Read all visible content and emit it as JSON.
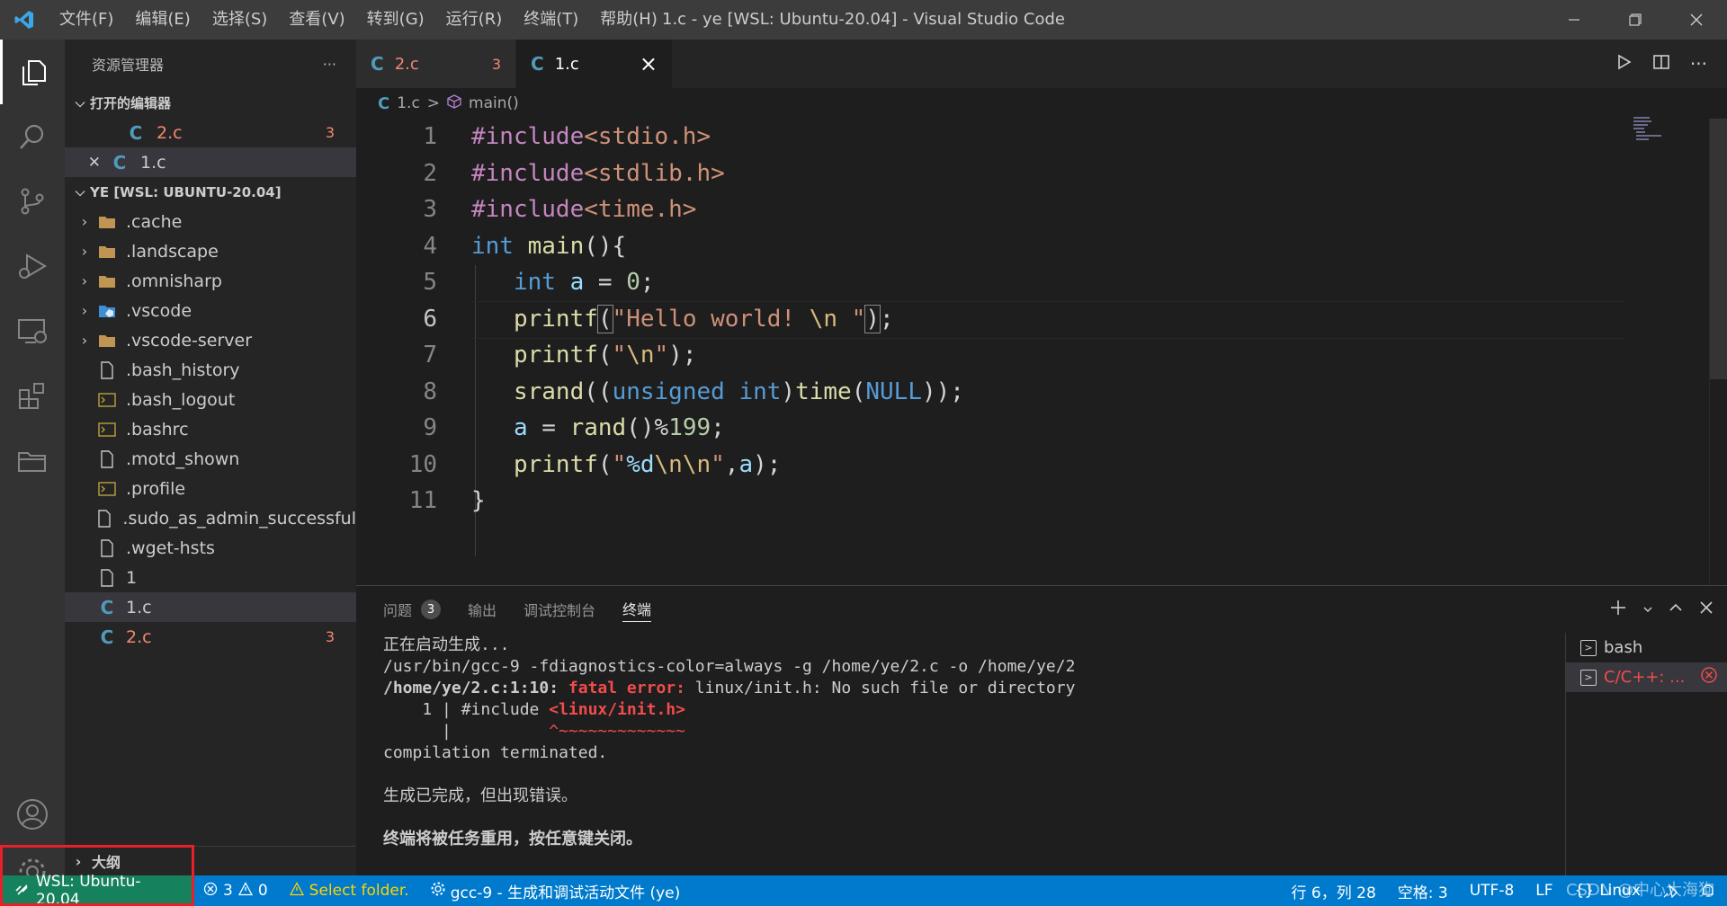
{
  "titlebar": {
    "menu": [
      "文件(F)",
      "编辑(E)",
      "选择(S)",
      "查看(V)",
      "转到(G)",
      "运行(R)",
      "终端(T)",
      "帮助(H)"
    ],
    "title": "1.c - ye [WSL: Ubuntu-20.04] - Visual Studio Code"
  },
  "sidebar": {
    "header": "资源管理器",
    "more": "···",
    "open_editors_label": "打开的编辑器",
    "open_editors": [
      {
        "name": "2.c",
        "badge": "3",
        "icon": "c-file-icon",
        "error": true
      },
      {
        "name": "1.c",
        "badge": "",
        "icon": "c-file-icon",
        "error": false
      }
    ],
    "workspace_label": "YE [WSL: UBUNTU-20.04]",
    "files": [
      {
        "name": ".cache",
        "kind": "folder"
      },
      {
        "name": ".landscape",
        "kind": "folder"
      },
      {
        "name": ".omnisharp",
        "kind": "folder"
      },
      {
        "name": ".vscode",
        "kind": "vscode-folder"
      },
      {
        "name": ".vscode-server",
        "kind": "folder"
      },
      {
        "name": ".bash_history",
        "kind": "file"
      },
      {
        "name": ".bash_logout",
        "kind": "shell"
      },
      {
        "name": ".bashrc",
        "kind": "shell"
      },
      {
        "name": ".motd_shown",
        "kind": "file"
      },
      {
        "name": ".profile",
        "kind": "shell"
      },
      {
        "name": ".sudo_as_admin_successful",
        "kind": "file"
      },
      {
        "name": ".wget-hsts",
        "kind": "file"
      },
      {
        "name": "1",
        "kind": "file"
      },
      {
        "name": "1.c",
        "kind": "c"
      },
      {
        "name": "2.c",
        "kind": "c",
        "badge": "3"
      }
    ],
    "outline_label": "大纲"
  },
  "editor": {
    "tabs": [
      {
        "label": "2.c",
        "badge": "3",
        "active": false
      },
      {
        "label": "1.c",
        "close": "×",
        "active": true
      }
    ],
    "breadcrumb": {
      "file": "1.c",
      "separator": ">",
      "symbol": "main()"
    },
    "line_numbers": [
      "1",
      "2",
      "3",
      "4",
      "5",
      "6",
      "7",
      "8",
      "9",
      "10",
      "11"
    ],
    "current_line": 6
  },
  "panel": {
    "tabs": [
      {
        "label": "问题",
        "badge": "3"
      },
      {
        "label": "输出"
      },
      {
        "label": "调试控制台"
      },
      {
        "label": "终端",
        "active": true
      }
    ],
    "terminal_lines": [
      "正在启动生成...",
      "/usr/bin/gcc-9 -fdiagnostics-color=always -g /home/ye/2.c -o /home/ye/2",
      "/home/ye/2.c:1:10: ",
      "fatal error:",
      " linux/init.h: No such file or directory",
      "    1 | #include ",
      "<linux/init.h>",
      "      |          ",
      "^~~~~~~~~~~~~~",
      "compilation terminated.",
      "生成已完成，但出现错误。",
      "终端将被任务重用，按任意键关闭。"
    ],
    "terminals": [
      {
        "label": "bash"
      },
      {
        "label": "C/C++: ..."
      }
    ]
  },
  "statusbar": {
    "remote": "WSL: Ubuntu-20.04",
    "errors": "3",
    "warnings": "0",
    "select_folder": "Select folder.",
    "task": "gcc-9 - 生成和调试活动文件 (ye)",
    "position": "行 6，列 28",
    "spaces": "空格: 3",
    "encoding": "UTF-8",
    "eol": "LF",
    "language": "Linux",
    "watermark": "CSDN @中心大海狗"
  },
  "colors": {
    "statusbar": "#007acc",
    "remote": "#16825d",
    "error": "#f48771",
    "annotation_box": "#e8202a"
  }
}
